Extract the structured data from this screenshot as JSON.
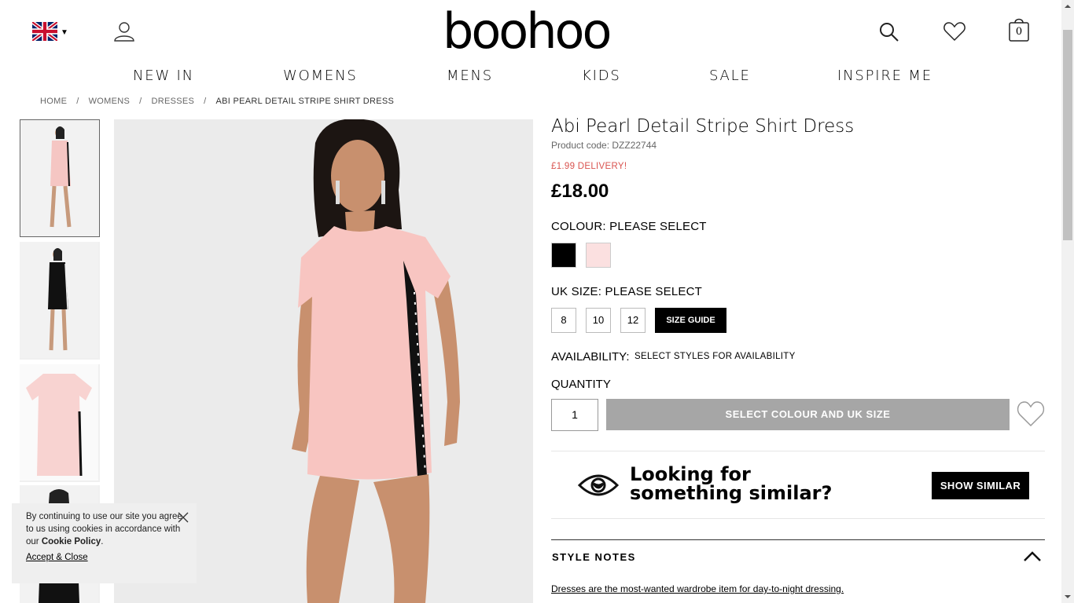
{
  "header": {
    "logo": "boohoo",
    "bag_count": "0"
  },
  "nav": [
    "NEW IN",
    "WOMENS",
    "MENS",
    "KIDS",
    "SALE",
    "INSPIRE ME"
  ],
  "breadcrumb": [
    "HOME",
    "WOMENS",
    "DRESSES",
    "ABI PEARL DETAIL STRIPE SHIRT DRESS"
  ],
  "product": {
    "title": "Abi Pearl Detail Stripe Shirt Dress",
    "code": "Product code: DZZ22744",
    "delivery": "£1.99 DELIVERY!",
    "price": "£18.00",
    "colour_label": "COLOUR:",
    "colour_value": "PLEASE SELECT",
    "colours": [
      {
        "name": "black",
        "hex": "#000000"
      },
      {
        "name": "pink",
        "hex": "#fbe0e0"
      }
    ],
    "size_label": "UK SIZE:",
    "size_value": "PLEASE SELECT",
    "sizes": [
      "8",
      "10",
      "12"
    ],
    "size_guide": "SIZE GUIDE",
    "availability_label": "AVAILABILITY:",
    "availability_value": "SELECT STYLES FOR AVAILABILITY",
    "quantity_label": "QUANTITY",
    "quantity": "1",
    "add_button": "SELECT COLOUR AND UK SIZE"
  },
  "similar": {
    "line1": "Looking for",
    "line2": "something similar?",
    "button": "SHOW SIMILAR"
  },
  "style_notes": {
    "title": "STYLE NOTES",
    "text": "Dresses are the most-wanted wardrobe item for day-to-night dressing."
  },
  "cookie": {
    "text_pre": "By continuing to use our site you agree to us using cookies in accordance with our ",
    "policy": "Cookie Policy",
    "text_post": ".",
    "accept": "Accept & Close"
  }
}
